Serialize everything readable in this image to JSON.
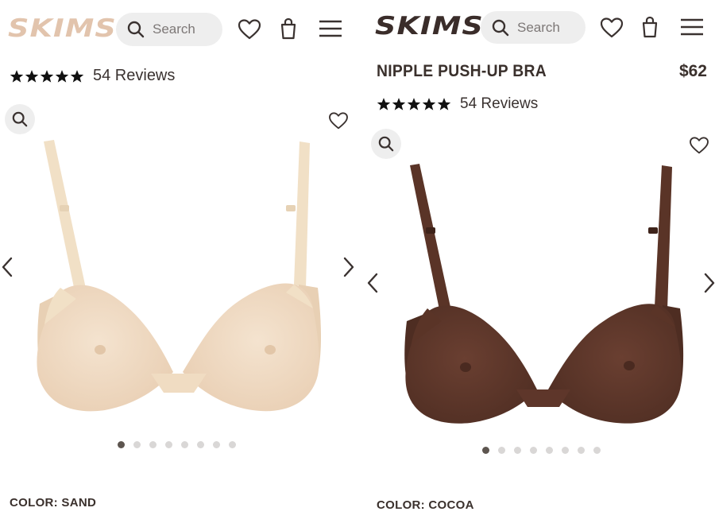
{
  "brand": {
    "logo_text": "SKIMS",
    "logo_color_sand": "#e2c4ad",
    "logo_color_dark": "#3a2d2a"
  },
  "left": {
    "search": {
      "placeholder": "Search"
    },
    "rating": {
      "stars": 5,
      "reviews": "54 Reviews"
    },
    "gallery": {
      "dots": 8,
      "active_index": 0
    },
    "color": "COLOR: SAND",
    "product_color_hex": "#efdcc6"
  },
  "right": {
    "search": {
      "placeholder": "Search"
    },
    "product": {
      "title": "NIPPLE PUSH-UP BRA",
      "price": "$62"
    },
    "rating": {
      "stars": 5,
      "reviews": "54 Reviews"
    },
    "gallery": {
      "dots": 8,
      "active_index": 0
    },
    "color": "COLOR: COCOA",
    "product_color_hex": "#5a3427"
  },
  "icons": {
    "search": "search-icon",
    "wishlist": "heart-icon",
    "bag": "shopping-bag-icon",
    "menu": "hamburger-menu-icon",
    "zoom": "zoom-icon",
    "prev": "chevron-left-icon",
    "next": "chevron-right-icon"
  }
}
